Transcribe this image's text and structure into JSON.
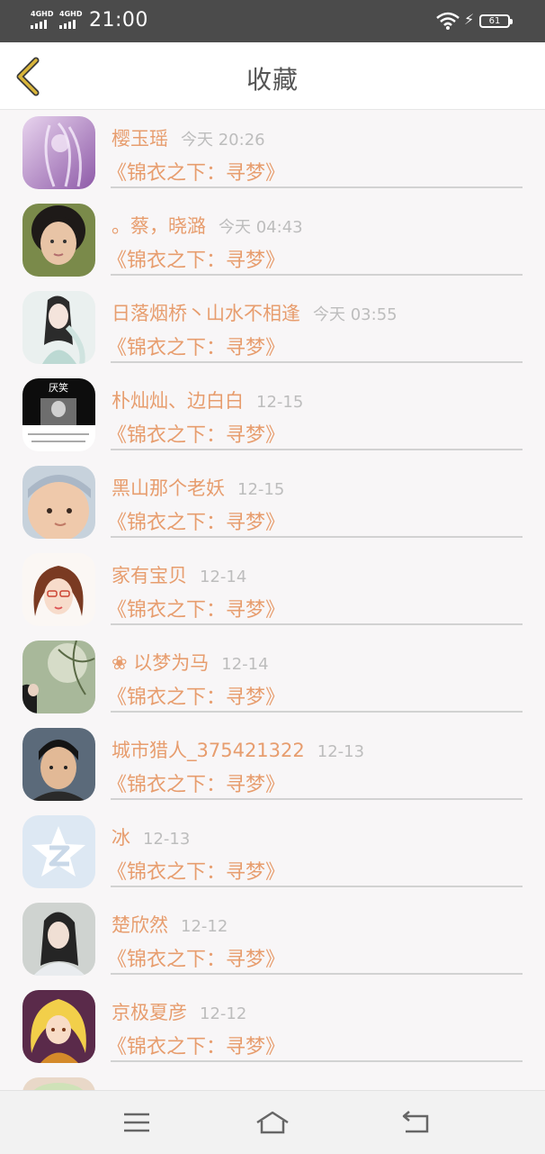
{
  "status_bar": {
    "network_1": "4G",
    "network_1_sup": "HD",
    "network_2": "4G",
    "network_2_sup": "HD",
    "time": "21:00",
    "battery": "61"
  },
  "header": {
    "title": "收藏"
  },
  "favorites": [
    {
      "name": "樱玉瑶",
      "time": "今天 20:26",
      "book": "《锦衣之下：寻梦》",
      "avatar": "purple-art"
    },
    {
      "name": "。蔡，晓潞",
      "time": "今天 04:43",
      "book": "《锦衣之下：寻梦》",
      "avatar": "girl-photo"
    },
    {
      "name": "日落烟桥丶山水不相逢",
      "time": "今天 03:55",
      "book": "《锦衣之下：寻梦》",
      "avatar": "ancient-lady"
    },
    {
      "name": "朴灿灿、边白白",
      "time": "12-15",
      "book": "《锦衣之下：寻梦》",
      "avatar": "black-card"
    },
    {
      "name": "黑山那个老妖",
      "time": "12-15",
      "book": "《锦衣之下：寻梦》",
      "avatar": "baby"
    },
    {
      "name": "家有宝贝",
      "time": "12-14",
      "book": "《锦衣之下：寻梦》",
      "avatar": "cartoon-girl"
    },
    {
      "name": "❀ 以梦为马",
      "time": "12-14",
      "book": "《锦衣之下：寻梦》",
      "avatar": "tree-scene"
    },
    {
      "name": "城市猎人_375421322",
      "time": "12-13",
      "book": "《锦衣之下：寻梦》",
      "avatar": "man-photo"
    },
    {
      "name": "冰",
      "time": "12-13",
      "book": "《锦衣之下：寻梦》",
      "avatar": "qq-default"
    },
    {
      "name": "楚欣然",
      "time": "12-12",
      "book": "《锦衣之下：寻梦》",
      "avatar": "woman-photo"
    },
    {
      "name": "京极夏彦",
      "time": "12-12",
      "book": "《锦衣之下：寻梦》",
      "avatar": "anime-girl"
    },
    {
      "name": "",
      "time": "",
      "book": "",
      "avatar": "partial"
    }
  ],
  "colors": {
    "accent": "#e79d6e",
    "time_gray": "#bdbdbd",
    "status_bar_bg": "#4b4b4b",
    "back_arrow": "#d9b53a"
  },
  "avatar_card_text": "厌笑"
}
